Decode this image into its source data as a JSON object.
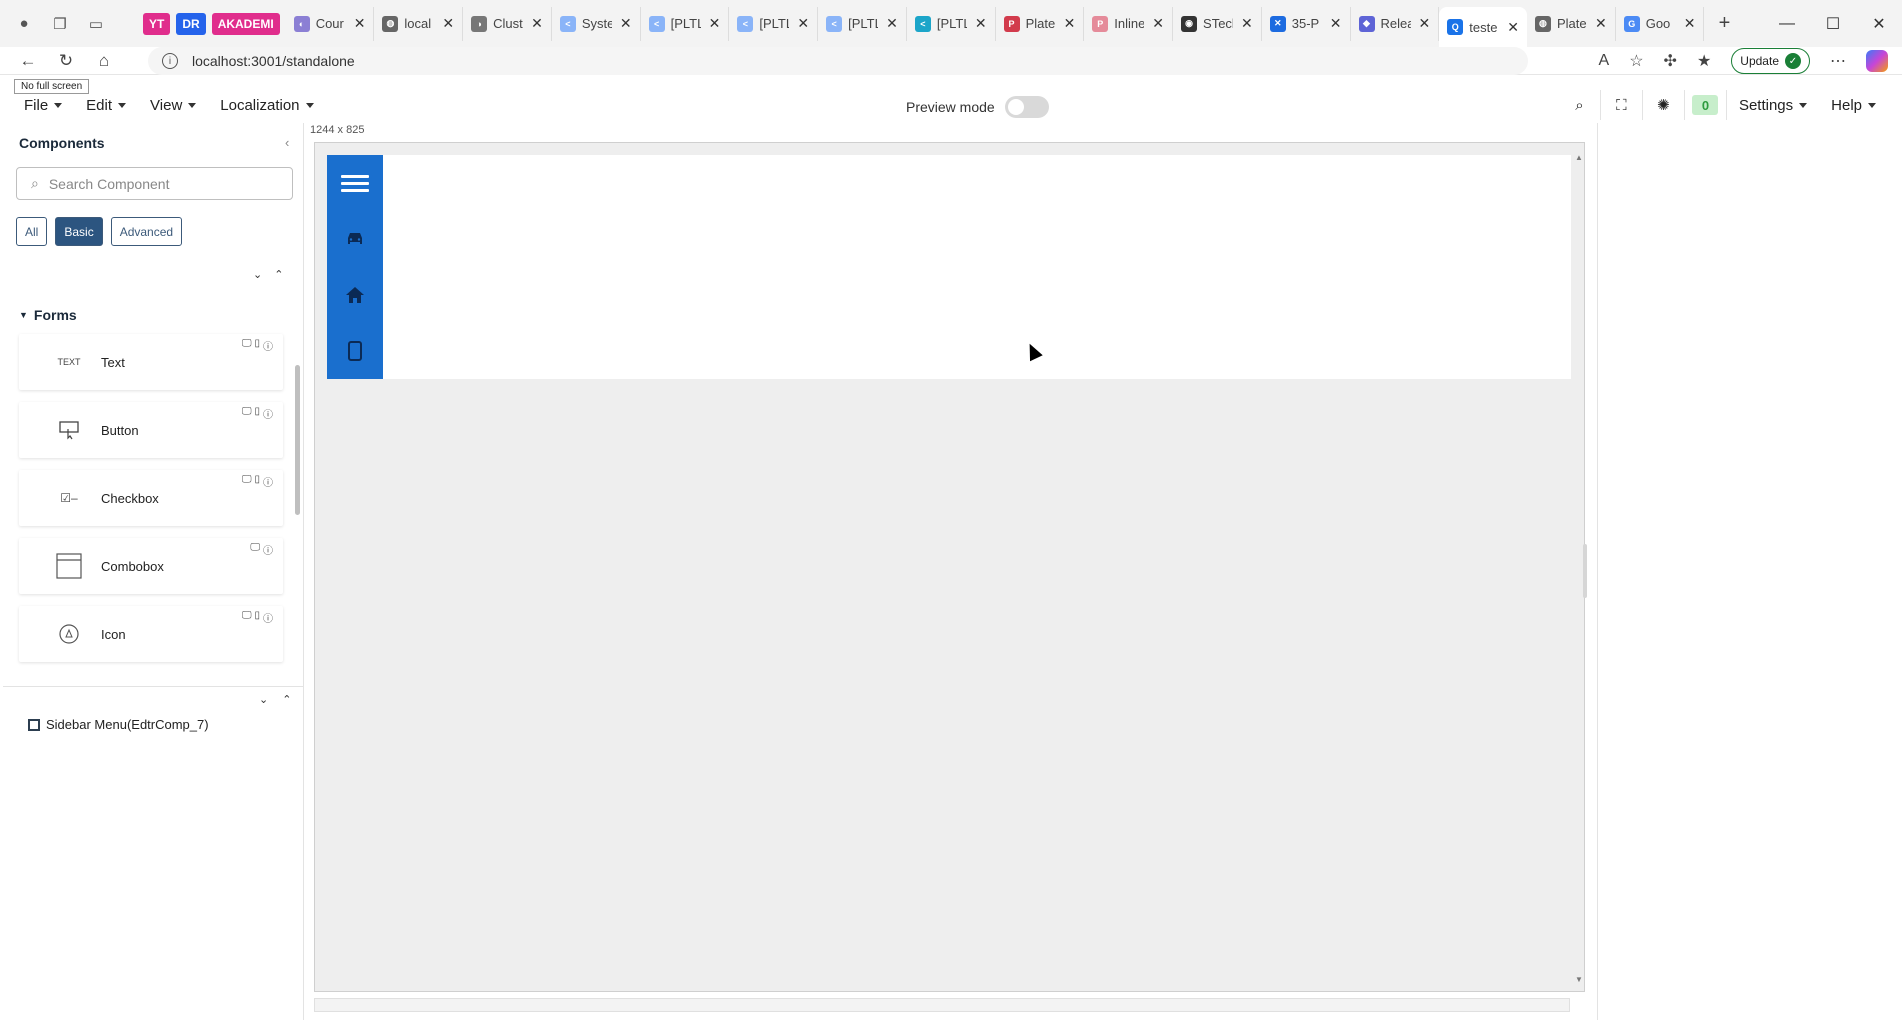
{
  "browser": {
    "pills": [
      {
        "label": "YT",
        "color": "#e02d8c"
      },
      {
        "label": "DR",
        "color": "#2563eb"
      },
      {
        "label": "AKADEMI",
        "color": "#e02d8c"
      }
    ],
    "tabs": [
      {
        "title": "Cour",
        "fav_color": "#8b7fd4",
        "fav": "◐"
      },
      {
        "title": "local",
        "fav_color": "#666666",
        "fav": "◍"
      },
      {
        "title": "Clust",
        "fav_color": "#777777",
        "fav": "◑"
      },
      {
        "title": "Syste",
        "fav_color": "#8ab4f8",
        "fav": "<"
      },
      {
        "title": "[PLTL",
        "fav_color": "#8ab4f8",
        "fav": "<"
      },
      {
        "title": "[PLTL",
        "fav_color": "#8ab4f8",
        "fav": "<"
      },
      {
        "title": "[PLTL",
        "fav_color": "#8ab4f8",
        "fav": "<"
      },
      {
        "title": "[PLTL",
        "fav_color": "#1ca5c9",
        "fav": "<"
      },
      {
        "title": "Plate",
        "fav_color": "#d23b4c",
        "fav": "P"
      },
      {
        "title": "Inline",
        "fav_color": "#e58b9a",
        "fav": "P"
      },
      {
        "title": "STecl",
        "fav_color": "#333333",
        "fav": "◉"
      },
      {
        "title": "35-P",
        "fav_color": "#1d6be0",
        "fav": "✕"
      },
      {
        "title": "Relea",
        "fav_color": "#5e64d6",
        "fav": "◆"
      },
      {
        "title": "teste",
        "fav_color": "#1a73e8",
        "fav": "Q",
        "active": true
      },
      {
        "title": "Plate",
        "fav_color": "#666666",
        "fav": "◍"
      },
      {
        "title": "Goo",
        "fav_color": "#4c8bf5",
        "fav": "G"
      }
    ],
    "url": "localhost:3001/standalone",
    "update_label": "Update"
  },
  "app": {
    "no_full_screen": "No full screen",
    "menus": [
      "File",
      "Edit",
      "View",
      "Localization"
    ],
    "preview_label": "Preview mode",
    "counter": "0",
    "settings_label": "Settings",
    "help_label": "Help",
    "canvas_size": "1244 x 825"
  },
  "components": {
    "title": "Components",
    "search_placeholder": "Search Component",
    "filters": [
      "All",
      "Basic",
      "Advanced"
    ],
    "active_filter": "Basic",
    "group": "Forms",
    "items": [
      {
        "label": "Text",
        "icon": "TEXT"
      },
      {
        "label": "Button",
        "icon": "button-icon"
      },
      {
        "label": "Checkbox",
        "icon": "checkbox-icon"
      },
      {
        "label": "Combobox",
        "icon": "combobox-icon"
      },
      {
        "label": "Icon",
        "icon": "icon-icon"
      }
    ]
  },
  "tree": {
    "item": "Sidebar Menu(EdtrComp_7)"
  },
  "colors": {
    "sidebar_blue": "#1a6fce",
    "filter_active": "#2c5580",
    "counter_bg": "#c7eecb"
  }
}
